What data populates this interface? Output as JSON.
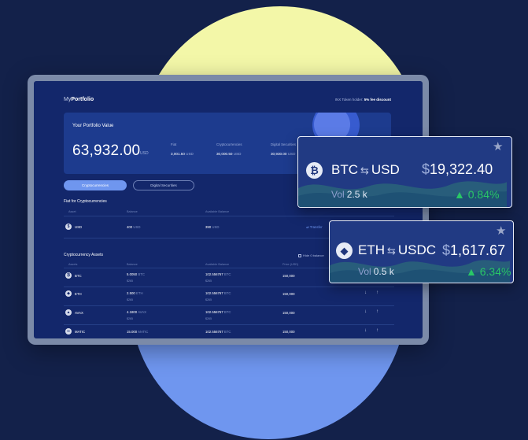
{
  "app": {
    "brand_prefix": "My",
    "brand_name": "Portfolio",
    "discount_prefix": "INX Token holder:",
    "discount_value": "5% fee discount"
  },
  "portfolio": {
    "label": "Your Portfolio Value",
    "amount": "63,932.00",
    "currency": "USD",
    "columns": [
      {
        "label": "Fiat",
        "value": "3,001.50",
        "unit": "USD"
      },
      {
        "label": "Cryptocurrencies",
        "value": "30,000.50",
        "unit": "USD"
      },
      {
        "label": "Digital Securities",
        "value": "30,930.00",
        "unit": "USD"
      }
    ]
  },
  "tabs": {
    "active": "Cryptocurrencies",
    "inactive": "Digital Securities"
  },
  "fiat_section": {
    "title": "Fiat for Cryptocurrencies",
    "headers": [
      "Asset",
      "Balance",
      "Available Balance"
    ],
    "row": {
      "asset": "USD",
      "balance": "400",
      "balance_unit": "USD",
      "available": "390",
      "available_unit": "USD",
      "action": "Transfer"
    }
  },
  "crypto_section": {
    "title": "Cryptocurrency Assets",
    "hide_zero": "Hide 0 balance",
    "headers": [
      "Assets",
      "Balance",
      "Available Balance",
      "Price (USD)"
    ],
    "rows": [
      {
        "asset": "BTC",
        "balance": "5.0050",
        "balance_unit": "BTC",
        "balance_sub": "$265",
        "available": "102.556767",
        "available_unit": "BTC",
        "available_sub": "$265",
        "price": "150,000"
      },
      {
        "asset": "ETH",
        "balance": "2.500",
        "balance_unit": "ETH",
        "balance_sub": "$265",
        "available": "102.556767",
        "available_unit": "BTC",
        "available_sub": "$265",
        "price": "150,000"
      },
      {
        "asset": "AVAX",
        "balance": "4.1800",
        "balance_unit": "AVAX",
        "balance_sub": "$265",
        "available": "102.556767",
        "available_unit": "BTC",
        "available_sub": "$265",
        "price": "150,000"
      },
      {
        "asset": "MATIC",
        "balance": "15.000",
        "balance_unit": "MATIC",
        "balance_sub": "",
        "available": "102.556767",
        "available_unit": "BTC",
        "available_sub": "",
        "price": "150,000"
      }
    ]
  },
  "cards": [
    {
      "base": "BTC",
      "quote": "USD",
      "price_currency": "$",
      "price": "19,322.40",
      "vol_label": "Vol",
      "vol": "2.5 k",
      "change": "0.84%"
    },
    {
      "base": "ETH",
      "quote": "USDC",
      "price_currency": "$",
      "price": "1,617.67",
      "vol_label": "Vol",
      "vol": "0.5 k",
      "change": "6.34%"
    }
  ],
  "colors": {
    "background": "#13214a",
    "accent_blue": "#6f96ef",
    "accent_yellow": "#f3f7a8",
    "positive": "#29c766"
  },
  "icons": {
    "btc": "bitcoin-icon",
    "eth": "ethereum-icon",
    "star": "star-icon",
    "swap": "swap-arrows-icon",
    "up": "triangle-up-icon"
  }
}
